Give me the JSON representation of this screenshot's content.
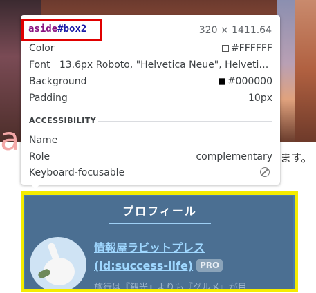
{
  "tooltip": {
    "selector_tag": "aside",
    "selector_id": "#box2",
    "dimensions": "320 × 1411.64",
    "props": [
      {
        "label": "Color",
        "value": "#FFFFFF",
        "swatch": "#FFFFFF"
      },
      {
        "label": "Font",
        "value": "13.6px Roboto, \"Helvetica Neue\", Helveti…"
      },
      {
        "label": "Background",
        "value": "#000000",
        "swatch": "#000000"
      },
      {
        "label": "Padding",
        "value": "10px"
      }
    ],
    "accessibility": {
      "heading": "ACCESSIBILITY",
      "name_label": "Name",
      "name_value": "",
      "role_label": "Role",
      "role_value": "complementary",
      "keyboard_label": "Keyboard-focusable",
      "keyboard_icon": "not-allowed-icon"
    }
  },
  "page": {
    "hero_text_fragment": "ます。",
    "pink_deco": "a"
  },
  "aside": {
    "title": "プロフィール",
    "blog_name": "情報屋ラビットプレス",
    "blog_id": "(id:success-life)",
    "pro_badge": "PRO",
    "description": "旅行は『観光』よりも『グルメ』が目",
    "highlight_color": "#F5EC00"
  }
}
